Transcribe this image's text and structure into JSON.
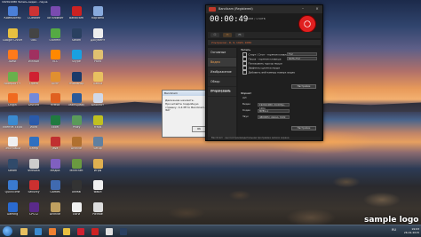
{
  "topbar": {
    "text": "1920x1080      Запись видео - пауза"
  },
  "desktop_icons": [
    {
      "label": "Компьютер",
      "color": "#4a7fd8"
    },
    {
      "label": "CCleaner",
      "color": "#cc3333"
    },
    {
      "label": "Tor Browser",
      "color": "#7a4bb0"
    },
    {
      "label": "Bandicam",
      "color": "#cc2222"
    },
    {
      "label": "Корзина",
      "color": "#88aadd"
    },
    {
      "label": "Google Chrome",
      "color": "#e8c040"
    },
    {
      "label": "OBS",
      "color": "#444444"
    },
    {
      "label": "uTorrent",
      "color": "#55aa44"
    },
    {
      "label": "Steam",
      "color": "#2a4060"
    },
    {
      "label": "Документ",
      "color": "#eeeeee"
    },
    {
      "label": "Avast",
      "color": "#ff7a1a"
    },
    {
      "label": "WinRAR",
      "color": "#a03060"
    },
    {
      "label": "VLC",
      "color": "#ff8800"
    },
    {
      "label": "Skype",
      "color": "#1aa0e0"
    },
    {
      "label": "Paint",
      "color": "#e0c070"
    },
    {
      "label": "Notepad++",
      "color": "#6ab04c"
    },
    {
      "label": "Opera",
      "color": "#d02030"
    },
    {
      "label": "AIMP",
      "color": "#e09030"
    },
    {
      "label": "Photoshop",
      "color": "#1a3a6a"
    },
    {
      "label": "Папка",
      "color": "#e8c060"
    },
    {
      "label": "Origin",
      "color": "#f06a20"
    },
    {
      "label": "Discord",
      "color": "#7289da"
    },
    {
      "label": "Firefox",
      "color": "#e06020"
    },
    {
      "label": "TeamSpeak",
      "color": "#2a5a9a"
    },
    {
      "label": "Блокнот",
      "color": "#d0d8e8"
    },
    {
      "label": "Internet Explorer",
      "color": "#3a8ad0"
    },
    {
      "label": "Word",
      "color": "#2a5aaa"
    },
    {
      "label": "Excel",
      "color": "#207a40"
    },
    {
      "label": "Proxy",
      "color": "#5a9a5a"
    },
    {
      "label": "Fraps",
      "color": "#c0c020"
    },
    {
      "label": "Текстовый",
      "color": "#f0f0f0"
    },
    {
      "label": "Плеер",
      "color": "#3070c0"
    },
    {
      "label": "Java",
      "color": "#c03030"
    },
    {
      "label": "Archive",
      "color": "#b07030"
    },
    {
      "label": "Setup",
      "color": "#6080a0"
    },
    {
      "label": "Steam",
      "color": "#304a6a"
    },
    {
      "label": "Флешка",
      "color": "#cccccc"
    },
    {
      "label": "Медиа",
      "color": "#8060c0"
    },
    {
      "label": "Minecraft",
      "color": "#6a9a40"
    },
    {
      "label": "Игры",
      "color": "#e0b050"
    },
    {
      "label": "QuickTime",
      "color": "#3a7ad0"
    },
    {
      "label": "Security",
      "color": "#cc3030"
    },
    {
      "label": "Games",
      "color": "#406ab0"
    },
    {
      "label": "Unreal",
      "color": "#333333"
    },
    {
      "label": "Файл",
      "color": "#f0f0f0"
    },
    {
      "label": "Gaming",
      "color": "#2a6ad0"
    },
    {
      "label": "CPU-Z",
      "color": "#5a2a8a"
    },
    {
      "label": "Archive",
      "color": "#c0a060"
    },
    {
      "label": "Логи",
      "color": "#f0f0f0"
    },
    {
      "label": "Разное",
      "color": "#dddddd"
    }
  ],
  "dialog": {
    "title": "Bandicam",
    "message": "Движение нажмите. Прочитайте подробную справку. 0-4 Pfl to Bandicam-Эй?",
    "ok_label": "OK"
  },
  "bandicam": {
    "title": "Bandicam (Registered)",
    "timer": "00:00:49",
    "timer_sub": "8.48М / 1.50ТБ",
    "modes": [
      "☐",
      "▭",
      "🎮"
    ],
    "info": "Ультраком - D, 9, 1920, 1080",
    "side_items": [
      "Основные",
      "Видео",
      "Изображение",
      "Обзор результатов",
      "О программе"
    ],
    "active_side": 1,
    "section_record": "Запись",
    "record_rows": [
      "Старт / Стоп  - горячая клавиша",
      "Пауза  - горячая клавиша",
      "Показывать курсор мыши",
      "Эффекты щелчка мыши",
      "Добавить веб-камеру поверх видео"
    ],
    "hotkey1": "F12",
    "hotkey2": "Shift+F12",
    "settings_btn": "Настройки",
    "section_format": "Формат",
    "format_value": "AVI",
    "format_rows": [
      {
        "label": "Видео",
        "value": "1920x1080, 24.00fps, 100q"
      },
      {
        "label": "Кодек",
        "value": "MPEG-1"
      },
      {
        "label": "Звук",
        "value": "48000Hz, stereo, 192k"
      }
    ],
    "settings_btn2": "Настройки",
    "status": "Bandicam - высокопроизводительная программа записи экрана"
  },
  "watermark": "sample logo",
  "taskbar": {
    "apps": [
      {
        "name": "explorer",
        "color": "#e8c060"
      },
      {
        "name": "ie",
        "color": "#3a8ad0"
      },
      {
        "name": "media",
        "color": "#f08030"
      },
      {
        "name": "chrome",
        "color": "#e8c040"
      },
      {
        "name": "opera",
        "color": "#d02030"
      },
      {
        "name": "bandicam",
        "color": "#cc2222"
      },
      {
        "name": "aimp",
        "color": "#e0e0e0"
      },
      {
        "name": "steam",
        "color": "#2a4060"
      }
    ],
    "lang": "RU",
    "time": "19:03",
    "date": "26.01.2015"
  }
}
